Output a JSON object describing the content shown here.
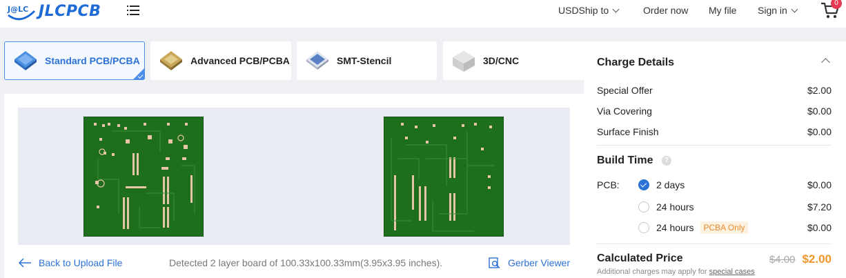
{
  "header": {
    "logo_text": "JLCPCB",
    "logo_mark_text": "J@LC",
    "nav": {
      "ship_to": "USDShip to",
      "order_now": "Order now",
      "my_file": "My file",
      "sign_in": "Sign in"
    },
    "cart_count": "0"
  },
  "tabs": [
    {
      "label": "Standard PCB/PCBA",
      "active": true
    },
    {
      "label": "Advanced PCB/PCBA",
      "active": false
    },
    {
      "label": "SMT-Stencil",
      "active": false
    },
    {
      "label": "3D/CNC",
      "active": false
    }
  ],
  "main": {
    "back_label": "Back to Upload File",
    "detected_text": "Detected 2 layer board of 100.33x100.33mm(3.95x3.95 inches).",
    "gerber_viewer_label": "Gerber Viewer"
  },
  "charge_details": {
    "title": "Charge Details",
    "items": [
      {
        "label": "Special Offer",
        "value": "$2.00"
      },
      {
        "label": "Via Covering",
        "value": "$0.00"
      },
      {
        "label": "Surface Finish",
        "value": "$0.00"
      }
    ]
  },
  "build_time": {
    "title": "Build Time",
    "help_glyph": "?",
    "pcb_label": "PCB:",
    "options": [
      {
        "label": "2 days",
        "value": "$0.00",
        "selected": true,
        "tag": ""
      },
      {
        "label": "24 hours",
        "value": "$7.20",
        "selected": false,
        "tag": ""
      },
      {
        "label": "24 hours",
        "value": "$0.00",
        "selected": false,
        "tag": "PCBA Only"
      }
    ]
  },
  "calculated": {
    "title": "Calculated Price",
    "original_price": "$4.00",
    "price": "$2.00",
    "note_prefix": "Additional charges may apply for",
    "note_link": "special cases"
  },
  "colors": {
    "brand_blue": "#1f6bd6",
    "accent_orange": "#f0962a",
    "pcb_green": "#1f6e1e",
    "badge_red": "#e63a52"
  }
}
